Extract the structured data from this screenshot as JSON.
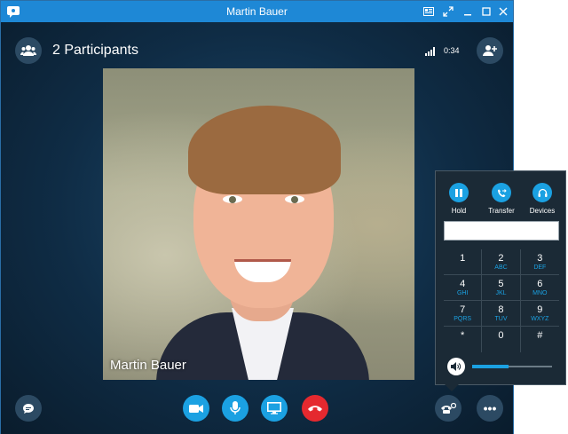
{
  "window": {
    "title": "Martin Bauer"
  },
  "header": {
    "participants_label": "2 Participants",
    "call_timer": "0:34"
  },
  "video": {
    "caller_name": "Martin Bauer"
  },
  "controls": {
    "chat_icon": "chat-icon",
    "video_icon": "video-camera-icon",
    "mic_icon": "microphone-icon",
    "screen_share_icon": "monitor-icon",
    "hangup_icon": "end-call-icon",
    "call_controls_icon": "call-controls-icon",
    "more_label": "•••"
  },
  "dialpad": {
    "actions": [
      {
        "label": "Hold",
        "icon": "pause-icon"
      },
      {
        "label": "Transfer",
        "icon": "transfer-icon"
      },
      {
        "label": "Devices",
        "icon": "headset-icon"
      }
    ],
    "number_value": "",
    "keys": [
      {
        "digit": "1",
        "letters": ""
      },
      {
        "digit": "2",
        "letters": "ABC"
      },
      {
        "digit": "3",
        "letters": "DEF"
      },
      {
        "digit": "4",
        "letters": "GHI"
      },
      {
        "digit": "5",
        "letters": "JKL"
      },
      {
        "digit": "6",
        "letters": "MNO"
      },
      {
        "digit": "7",
        "letters": "PQRS"
      },
      {
        "digit": "8",
        "letters": "TUV"
      },
      {
        "digit": "9",
        "letters": "WXYZ"
      },
      {
        "digit": "*",
        "letters": ""
      },
      {
        "digit": "0",
        "letters": ""
      },
      {
        "digit": "#",
        "letters": ""
      }
    ],
    "volume_percent": 45
  },
  "colors": {
    "accent": "#1ba1e2",
    "titlebar": "#1e88d6",
    "hangup": "#e5292f"
  }
}
